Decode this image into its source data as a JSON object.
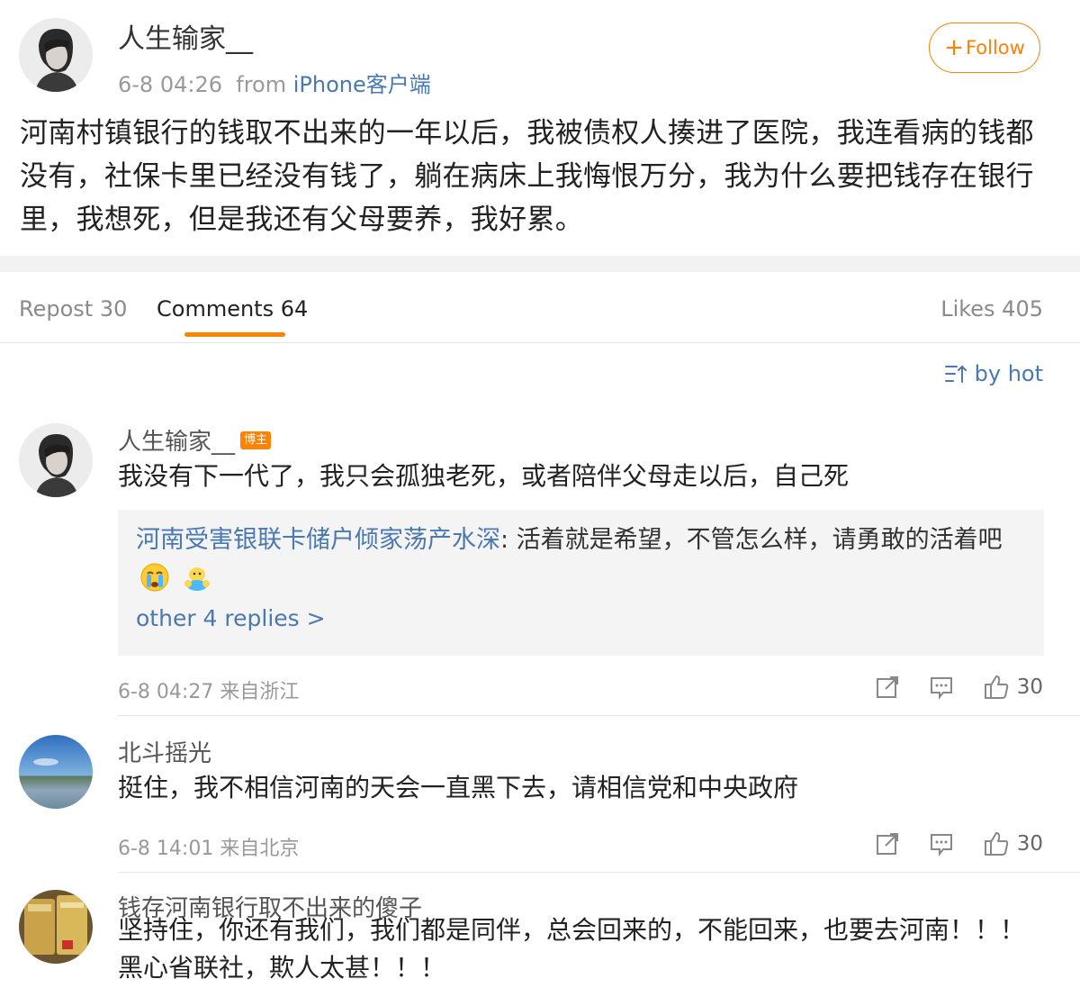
{
  "post": {
    "author": "人生输家__",
    "time": "6-8 04:26",
    "from_label": "from",
    "client": "iPhone客户端",
    "follow_label": "Follow",
    "text": "河南村镇银行的钱取不出来的一年以后，我被债权人揍进了医院，我连看病的钱都没有，社保卡里已经没有钱了，躺在病床上我悔恨万分，我为什么要把钱存在银行里，我想死，但是我还有父母要养，我好累。"
  },
  "tabs": {
    "repost": "Repost 30",
    "comments": "Comments 64",
    "likes": "Likes 405"
  },
  "sort_label": "by hot",
  "comments": [
    {
      "name": "人生输家__",
      "badge": "博主",
      "text": "我没有下一代了，我只会孤独老死，或者陪伴父母走以后，自己死",
      "reply": {
        "user": "河南受害银联卡储户倾家荡产水深",
        "text": ": 活着就是希望，不管怎么样，请勇敢的活着吧",
        "more": "other 4 replies >"
      },
      "time": "6-8 04:27 来自浙江",
      "likes": "30"
    },
    {
      "name": "北斗摇光",
      "text": "挺住，我不相信河南的天会一直黑下去，请相信党和中央政府",
      "time": "6-8 14:01 来自北京",
      "likes": "30"
    },
    {
      "name": "钱存河南银行取不出来的傻子",
      "text": "坚持住，你还有我们，我们都是同伴，总会回来的，不能回来，也要去河南！！！黑心省联社，欺人太甚！！！"
    }
  ]
}
